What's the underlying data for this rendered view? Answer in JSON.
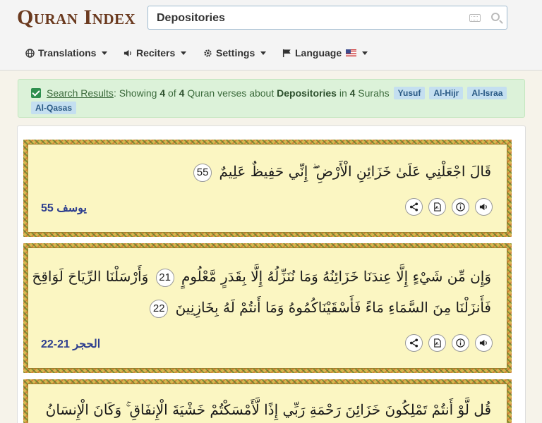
{
  "header": {
    "logo_text": "Quran Index",
    "search": {
      "value": "Depositories"
    }
  },
  "nav": [
    {
      "label": "Translations",
      "icon": "globe-icon"
    },
    {
      "label": "Reciters",
      "icon": "speaker-icon"
    },
    {
      "label": "Settings",
      "icon": "gear-icon"
    },
    {
      "label": "Language",
      "icon": "flag-icon"
    }
  ],
  "alert": {
    "link_text": "Search Results",
    "prefix": ": Showing ",
    "count_shown": "4",
    "of_text": " of ",
    "count_total": "4",
    "middle_text": " Quran verses about ",
    "topic": "Depositories",
    "in_text": " in ",
    "surah_count": "4",
    "suffix": " Surahs",
    "tags": [
      "Yusuf",
      "Al-Hijr",
      "Al-Israa",
      "Al-Qasas"
    ]
  },
  "verses": [
    {
      "line1": "قَالَ اجْعَلْنِي عَلَىٰ خَزَائِنِ الْأَرْضِ ۖ إِنِّي حَفِيظٌ عَلِيمٌ",
      "num1": "55",
      "ref": "يوسف 55"
    },
    {
      "line1": "وَإِن مِّن شَيْءٍ إِلَّا عِندَنَا خَزَائِنُهُ وَمَا نُنَزِّلُهُ إِلَّا بِقَدَرٍ مَّعْلُومٍ",
      "num1": "21",
      "line1b": "وَأَرْسَلْنَا الرِّيَاحَ لَوَاقِحَ",
      "line2": "فَأَنزَلْنَا مِنَ السَّمَاءِ مَاءً فَأَسْقَيْنَاكُمُوهُ وَمَا أَنتُمْ لَهُ بِخَازِنِينَ",
      "num2": "22",
      "ref": "الحجر 21-22"
    },
    {
      "line1": "قُل لَّوْ أَنتُمْ تَمْلِكُونَ خَزَائِنَ رَحْمَةِ رَبِّي إِذًا لَّأَمْسَكْتُمْ خَشْيَةَ الْإِنفَاقِ ۚ وَكَانَ الْإِنسَانُ"
    }
  ]
}
